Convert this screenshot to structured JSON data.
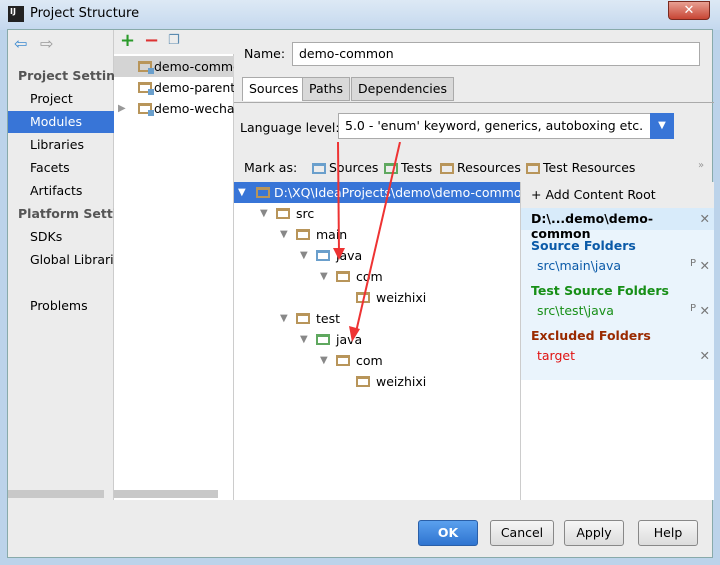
{
  "window": {
    "title": "Project Structure",
    "app_icon": "IJ"
  },
  "nav": {
    "back": "back-arrow-icon",
    "forward": "forward-arrow-icon",
    "project_settings": "Project Settings",
    "items1": [
      "Project",
      "Modules",
      "Libraries",
      "Facets",
      "Artifacts"
    ],
    "platform_settings": "Platform Settings",
    "items2": [
      "SDKs",
      "Global Libraries"
    ],
    "problems": "Problems",
    "selected": "Modules"
  },
  "modules": {
    "items": [
      "demo-common",
      "demo-parent",
      "demo-wechat"
    ],
    "selected": "demo-common"
  },
  "name": {
    "label": "Name:",
    "value": "demo-common"
  },
  "tabs": [
    "Sources",
    "Paths",
    "Dependencies"
  ],
  "language": {
    "label": "Language level:",
    "value": "5.0 - 'enum' keyword, generics, autoboxing etc."
  },
  "mark": {
    "label": "Mark as:",
    "items": [
      "Sources",
      "Tests",
      "Resources",
      "Test Resources"
    ],
    "more": "»"
  },
  "tree": {
    "root": "D:\\XQ\\IdeaProjects\\demo\\demo-common",
    "nodes": [
      "src",
      "main",
      "java",
      "com",
      "weizhixi",
      "test",
      "java",
      "com",
      "weizhixi"
    ]
  },
  "roots": {
    "add": "Add Content Root",
    "root": "D:\\...demo\\demo-common",
    "source_title": "Source Folders",
    "source": "src\\main\\java",
    "test_title": "Test Source Folders",
    "test": "src\\test\\java",
    "excluded_title": "Excluded Folders",
    "excluded": "target",
    "colors": {
      "source": "#0b5aa8",
      "test": "#178f17",
      "excluded": "#9a2a00"
    }
  },
  "buttons": {
    "ok": "OK",
    "cancel": "Cancel",
    "apply": "Apply",
    "help": "Help"
  }
}
